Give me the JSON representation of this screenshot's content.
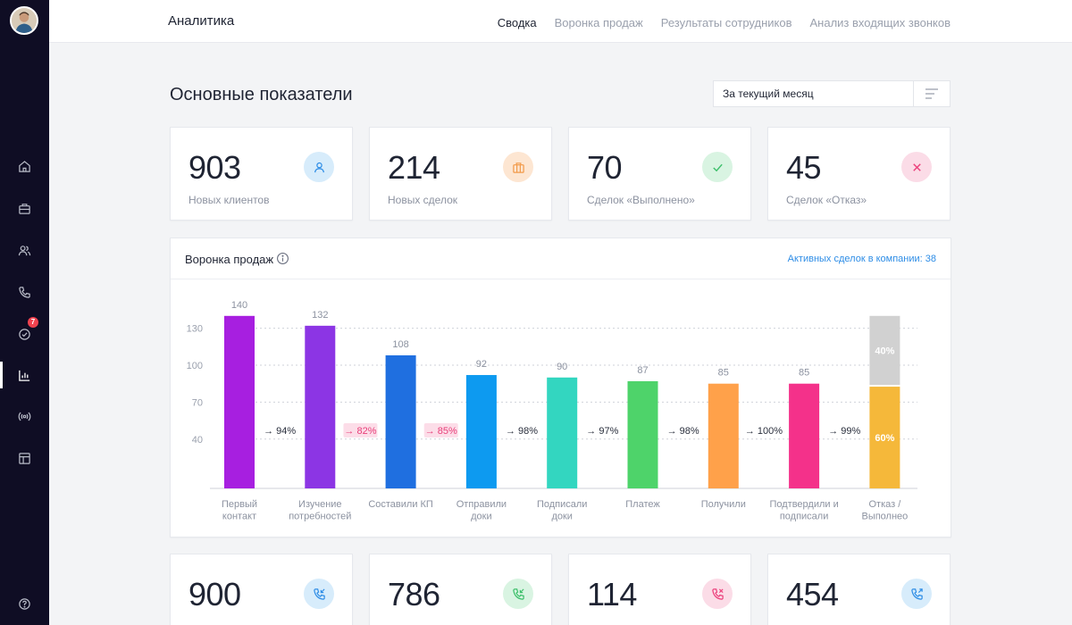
{
  "sidebar": {
    "items": [
      {
        "icon": "home-icon",
        "active": false
      },
      {
        "icon": "briefcase-icon",
        "active": false
      },
      {
        "icon": "users-icon",
        "active": false
      },
      {
        "icon": "phone-icon",
        "active": false
      },
      {
        "icon": "check-circle-icon",
        "active": false,
        "badge": "7"
      },
      {
        "icon": "bar-chart-icon",
        "active": true
      },
      {
        "icon": "broadcast-icon",
        "active": false
      },
      {
        "icon": "layout-icon",
        "active": false
      },
      {
        "icon": "help-icon",
        "active": false
      }
    ]
  },
  "header": {
    "title": "Аналитика",
    "tabs": [
      {
        "label": "Сводка",
        "active": true
      },
      {
        "label": "Воронка продаж",
        "active": false
      },
      {
        "label": "Результаты сотрудников",
        "active": false
      },
      {
        "label": "Анализ входящих звонков",
        "active": false
      }
    ]
  },
  "main": {
    "title": "Основные показатели",
    "period": "За текущий месяц",
    "kpis": [
      {
        "value": "903",
        "label": "Новых клиентов",
        "icon": "user-icon",
        "color": "#2e8de6",
        "bg": "#d7ecfb"
      },
      {
        "value": "214",
        "label": "Новых сделок",
        "icon": "briefcase-icon",
        "color": "#f29a4a",
        "bg": "#fde6d2"
      },
      {
        "value": "70",
        "label": "Сделок «Выполнено»",
        "icon": "check-icon",
        "color": "#3cbf6a",
        "bg": "#d9f4e2"
      },
      {
        "value": "45",
        "label": "Сделок «Отказ»",
        "icon": "close-icon",
        "color": "#ec3f7b",
        "bg": "#fbdce7"
      }
    ],
    "kpis_bottom": [
      {
        "value": "900",
        "icon": "phone-incoming-icon",
        "color": "#2e8de6",
        "bg": "#d7ecfb"
      },
      {
        "value": "786",
        "icon": "phone-outgoing-icon",
        "color": "#3cbf6a",
        "bg": "#d9f4e2"
      },
      {
        "value": "114",
        "icon": "phone-missed-icon",
        "color": "#ec3f7b",
        "bg": "#fbdce7"
      },
      {
        "value": "454",
        "icon": "phone-call-icon",
        "color": "#2e8de6",
        "bg": "#d7ecfb"
      }
    ]
  },
  "funnel": {
    "title": "Воронка продаж",
    "active_deals": "Активных сделок в компании: 38"
  },
  "chart_data": {
    "type": "bar",
    "title": "",
    "categories": [
      [
        "Первый",
        "контакт"
      ],
      [
        "Изучение",
        "потребностей"
      ],
      [
        "Составили КП"
      ],
      [
        "Отправили",
        "доки"
      ],
      [
        "Подписали",
        "доки"
      ],
      [
        "Платеж"
      ],
      [
        "Получили"
      ],
      [
        "Подтвердили и",
        "подписали"
      ],
      [
        "Отказ /",
        "Выполнео"
      ]
    ],
    "values": [
      140,
      132,
      108,
      92,
      90,
      87,
      85,
      85,
      140
    ],
    "value_labels": [
      "140",
      "132",
      "108",
      "92",
      "90",
      "87",
      "85",
      "85",
      ""
    ],
    "colors": [
      "#a71fe0",
      "#8c35e4",
      "#1f6fe0",
      "#0d9af0",
      "#33d6c0",
      "#4ed36a",
      "#ffa14a",
      "#f4318a",
      "#f5b83a"
    ],
    "conversions": [
      {
        "label": "→ 94%",
        "highlight": false
      },
      {
        "label": "→ 82%",
        "highlight": true
      },
      {
        "label": "→ 85%",
        "highlight": true
      },
      {
        "label": "→ 98%",
        "highlight": false
      },
      {
        "label": "→ 97%",
        "highlight": false
      },
      {
        "label": "→ 98%",
        "highlight": false
      },
      {
        "label": "→ 100%",
        "highlight": false
      },
      {
        "label": "→ 99%",
        "highlight": false
      }
    ],
    "split_last": {
      "top_label": "40%",
      "bottom_label": "60%",
      "top_color": "#d1d1d1",
      "bottom_color": "#f5b83a",
      "top_share": 0.4
    },
    "yticks": [
      40,
      70,
      100,
      130
    ],
    "ylim": [
      0,
      140
    ],
    "grid": true
  }
}
